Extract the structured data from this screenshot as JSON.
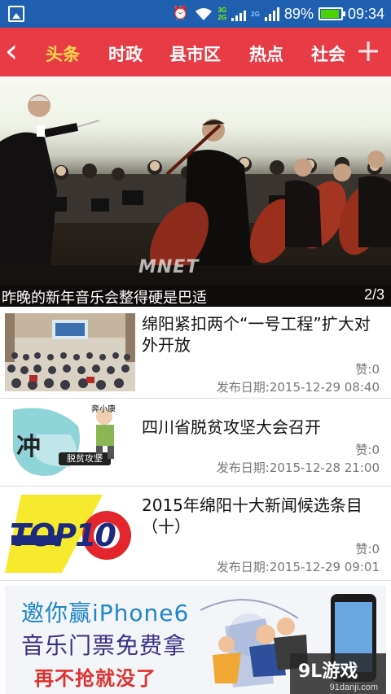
{
  "status_bar": {
    "battery": "89%",
    "time": "09:34",
    "net1": [
      "3G",
      "2G"
    ],
    "net2": "2G",
    "icons": [
      "image-icon",
      "alarm-icon",
      "wifi-icon",
      "signal-icon",
      "battery-icon"
    ]
  },
  "nav": {
    "back_icon": "chevron-left-icon",
    "tabs": [
      "头条",
      "时政",
      "县市区",
      "热点",
      "社会"
    ],
    "active_tab": 0,
    "add_icon": "plus-icon",
    "background": "#e73c45",
    "active_color": "#ffd84a"
  },
  "banner": {
    "caption": "昨晚的新年音乐会整得硬是巴适",
    "page": "2/3",
    "watermark": "MNET"
  },
  "news": [
    {
      "title": "绵阳紧扣两个“一号工程”扩大对外开放",
      "likes": "赞:0",
      "date": "发布日期:2015-12-29 08:40"
    },
    {
      "title": "四川省脱贫攻坚大会召开",
      "likes": "赞:0",
      "date": "发布日期:2015-12-28 21:00",
      "thumb_text": [
        "脱贫攻坚",
        "奔小康",
        "冲"
      ]
    },
    {
      "title": "2015年绵阳十大新闻候选条目（十）",
      "likes": "赞:0",
      "date": "发布日期:2015-12-29 09:01",
      "thumb_text": "TOP10"
    }
  ],
  "ad": {
    "line1": "邀你赢iPhone6",
    "line2": "音乐门票免费拿",
    "line3": "再不抢就没了",
    "logo": "9L游戏",
    "logo_sub": "91danji.com"
  }
}
